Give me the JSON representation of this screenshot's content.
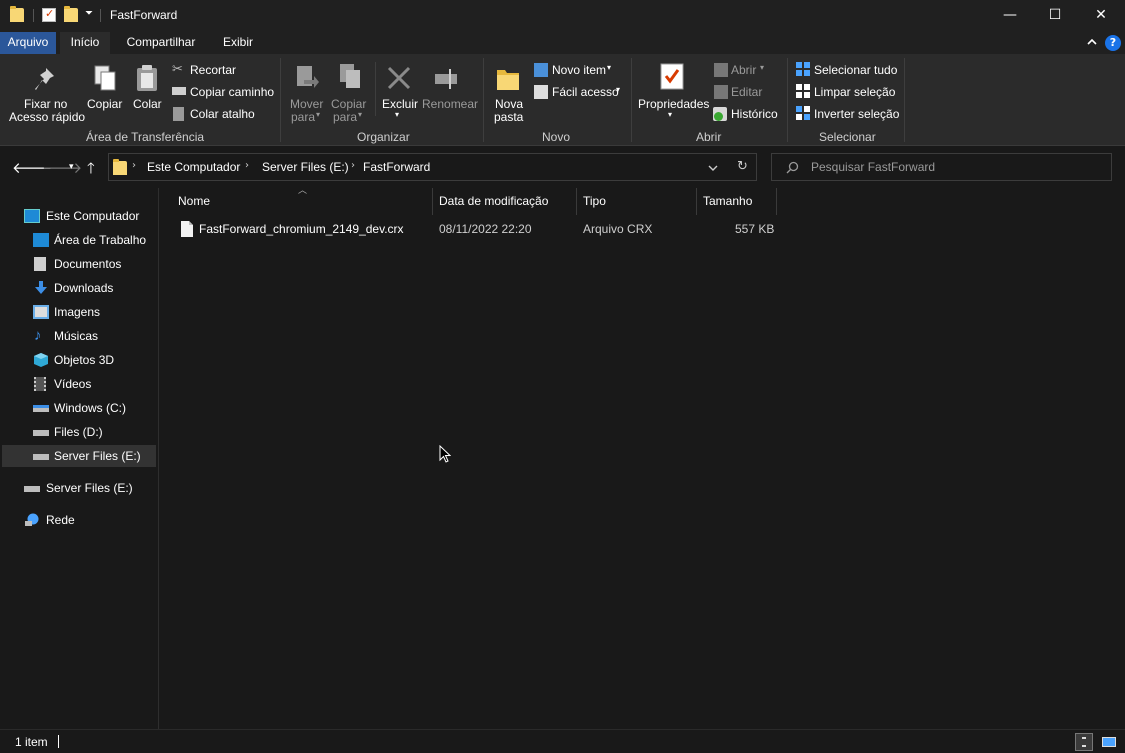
{
  "window": {
    "title": "FastForward",
    "minimize_glyph": "—",
    "maximize_glyph": "☐",
    "close_glyph": "✕"
  },
  "tabs": [
    {
      "label": "Arquivo"
    },
    {
      "label": "Início"
    },
    {
      "label": "Compartilhar"
    },
    {
      "label": "Exibir"
    }
  ],
  "help_glyph": "?",
  "ribbon": {
    "clipboard": {
      "pin": "Fixar no",
      "pin2": "Acesso rápido",
      "copy": "Copiar",
      "paste": "Colar",
      "cut": "Recortar",
      "copy_path": "Copiar caminho",
      "paste_shortcut": "Colar atalho",
      "group": "Área de Transferência"
    },
    "organize": {
      "move": "Mover",
      "move2": "para",
      "copy": "Copiar",
      "copy2": "para",
      "delete": "Excluir",
      "rename": "Renomear",
      "group": "Organizar"
    },
    "new": {
      "folder": "Nova",
      "folder2": "pasta",
      "new_item": "Novo item",
      "easy_access": "Fácil acesso",
      "group": "Novo"
    },
    "open": {
      "properties": "Propriedades",
      "open": "Abrir",
      "edit": "Editar",
      "history": "Histórico",
      "group": "Abrir"
    },
    "select": {
      "select_all": "Selecionar tudo",
      "select_none": "Limpar seleção",
      "invert": "Inverter seleção",
      "group": "Selecionar"
    }
  },
  "address": {
    "crumbs": [
      "Este Computador",
      "Server Files (E:)",
      "FastForward"
    ],
    "search_placeholder": "Pesquisar FastForward"
  },
  "nav_pane": {
    "items": [
      {
        "label": "Este Computador",
        "icon": "computer-icon"
      },
      {
        "label": "Área de Trabalho",
        "icon": "desktop-icon"
      },
      {
        "label": "Documentos",
        "icon": "documents-icon"
      },
      {
        "label": "Downloads",
        "icon": "downloads-icon"
      },
      {
        "label": "Imagens",
        "icon": "pictures-icon"
      },
      {
        "label": "Músicas",
        "icon": "music-icon"
      },
      {
        "label": "Objetos 3D",
        "icon": "objects-3d-icon"
      },
      {
        "label": "Vídeos",
        "icon": "videos-icon"
      },
      {
        "label": "Windows (C:)",
        "icon": "windows-drive-icon"
      },
      {
        "label": "Files (D:)",
        "icon": "drive-icon"
      },
      {
        "label": "Server Files (E:)",
        "icon": "drive-icon",
        "selected": true
      },
      {
        "label": "Server Files (E:)",
        "icon": "drive-icon"
      },
      {
        "label": "Rede",
        "icon": "network-icon"
      }
    ]
  },
  "file_list": {
    "columns": [
      "Nome",
      "Data de modificação",
      "Tipo",
      "Tamanho"
    ],
    "rows": [
      {
        "name": "FastForward_chromium_2149_dev.crx",
        "modified": "08/11/2022 22:20",
        "type": "Arquivo CRX",
        "size": "557 KB"
      }
    ]
  },
  "status": {
    "count": "1 item"
  },
  "colors": {
    "accent": "#2b579a",
    "background": "#191919",
    "ribbon": "#2b2b2b"
  }
}
